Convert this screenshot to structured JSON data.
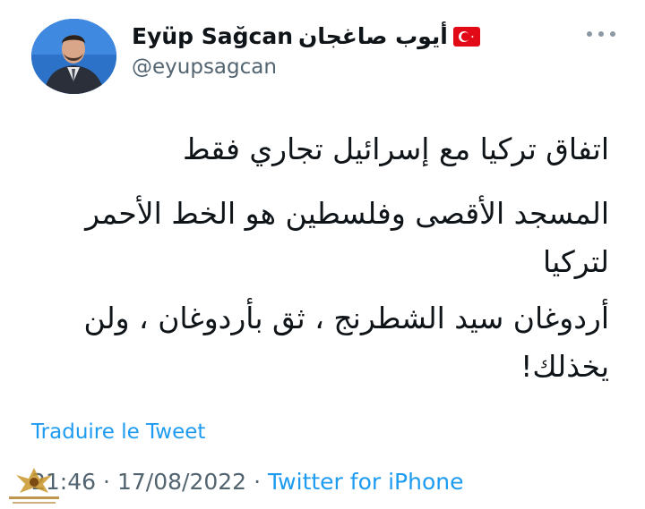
{
  "header": {
    "display_name": "Eyüp Sağcan",
    "arabic_name": "أيوب صاغجان",
    "flag_icon": "turkey-flag-icon",
    "handle": "@eyupsagcan",
    "more_icon": "more-options-icon"
  },
  "tweet": {
    "paragraph_1": "اتفاق تركيا مع إسرائيل تجاري فقط",
    "paragraph_2": "المسجد الأقصى وفلسطين هو الخط الأحمر لتركيا",
    "paragraph_3": "أردوغان سيد الشطرنج ، ثق بأردوغان ، ولن يخذلك!"
  },
  "translate_label": "Traduire le Tweet",
  "meta": {
    "time": "21:46",
    "separator_1": "·",
    "date": "17/08/2022",
    "separator_2": "·",
    "source": "Twitter for iPhone"
  },
  "colors": {
    "link": "#1d9bf0",
    "secondary_text": "#536471",
    "primary_text": "#0f1419"
  }
}
